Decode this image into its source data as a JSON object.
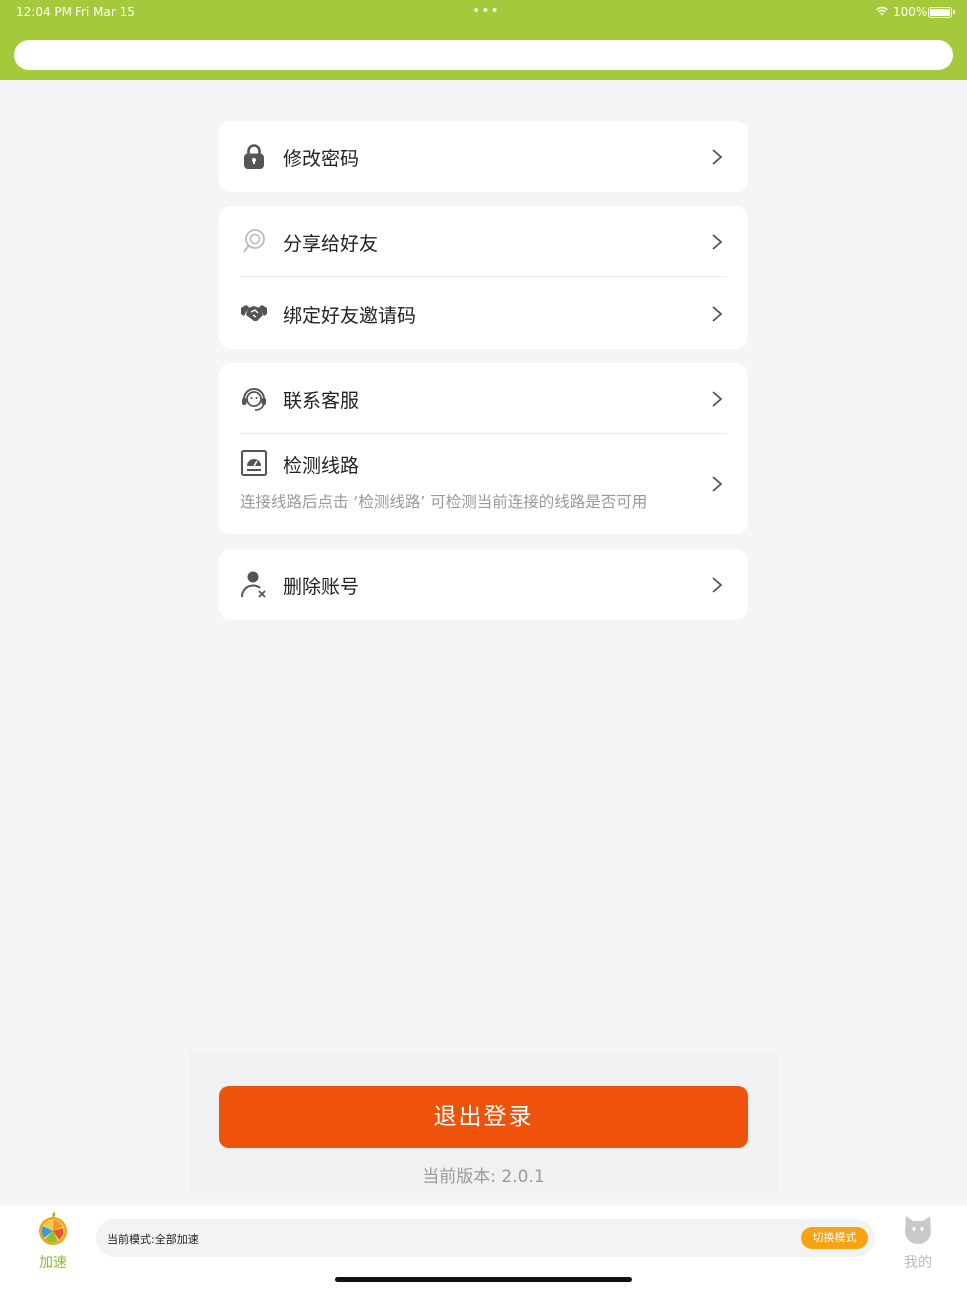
{
  "status_bar": {
    "time": "12:04 PM",
    "date": "Fri Mar 15",
    "dots": "•••",
    "battery_pct": "100%"
  },
  "colors": {
    "header": "#a4c93a",
    "logout": "#ef520b",
    "mode_button": "#f6a212",
    "icon": "#555555",
    "active_tab": "#8fbf2a"
  },
  "menu": {
    "change_password": {
      "label": "修改密码",
      "icon": "lock-icon"
    },
    "share_friends": {
      "label": "分享给好友",
      "icon": "share-icon"
    },
    "bind_invite": {
      "label": "绑定好友邀请码",
      "icon": "handshake-icon"
    },
    "contact_support": {
      "label": "联系客服",
      "icon": "headset-icon"
    },
    "check_route": {
      "label": "检测线路",
      "icon": "speedometer-icon",
      "description": "连接线路后点击 ‘检测线路’ 可检测当前连接的线路是否可用"
    },
    "delete_account": {
      "label": "删除账号",
      "icon": "user-delete-icon"
    }
  },
  "logout": {
    "label": "退出登录"
  },
  "version": "当前版本: 2.0.1",
  "tabbar": {
    "accelerate": {
      "label": "加速",
      "icon": "orange-slice-icon"
    },
    "mine": {
      "label": "我的",
      "icon": "cat-face-icon"
    },
    "mode_text": "当前模式:全部加速",
    "switch_mode": "切换模式"
  }
}
